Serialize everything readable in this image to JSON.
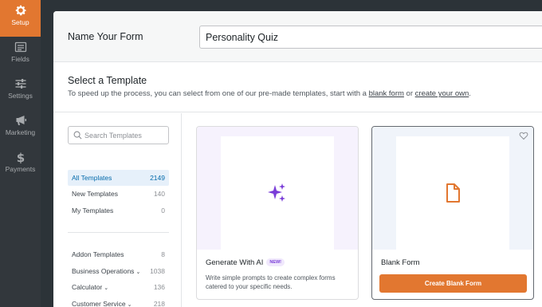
{
  "sidebar": {
    "items": [
      {
        "label": "Setup",
        "icon": "gear-icon",
        "active": true
      },
      {
        "label": "Fields",
        "icon": "fields-icon",
        "active": false
      },
      {
        "label": "Settings",
        "icon": "sliders-icon",
        "active": false
      },
      {
        "label": "Marketing",
        "icon": "megaphone-icon",
        "active": false
      },
      {
        "label": "Payments",
        "icon": "dollar-icon",
        "active": false
      }
    ]
  },
  "form_name": {
    "label": "Name Your Form",
    "value": "Personality Quiz"
  },
  "template_section": {
    "title": "Select a Template",
    "desc_prefix": "To speed up the process, you can select from one of our pre-made templates, start with a ",
    "blank_link": "blank form",
    "desc_middle": " or ",
    "create_link": "create your own",
    "desc_suffix": "."
  },
  "search": {
    "placeholder": "Search Templates"
  },
  "categories": [
    {
      "name": "All Templates",
      "count": "2149",
      "active": true
    },
    {
      "name": "New Templates",
      "count": "140"
    },
    {
      "name": "My Templates",
      "count": "0"
    },
    {
      "name": "Addon Templates",
      "count": "8"
    },
    {
      "name": "Business Operations",
      "count": "1038",
      "expandable": true
    },
    {
      "name": "Calculator",
      "count": "136",
      "expandable": true
    },
    {
      "name": "Customer Service",
      "count": "218",
      "expandable": true
    }
  ],
  "cards": {
    "ai": {
      "title": "Generate With AI",
      "badge": "NEW!",
      "description": "Write simple prompts to create complex forms catered to your specific needs.",
      "icon": "sparkles-icon"
    },
    "blank": {
      "title": "Blank Form",
      "button": "Create Blank Form",
      "icon": "document-icon"
    }
  },
  "colors": {
    "accent": "#e27730",
    "ai_purple": "#7a3dd8",
    "link_blue": "#036aab"
  }
}
